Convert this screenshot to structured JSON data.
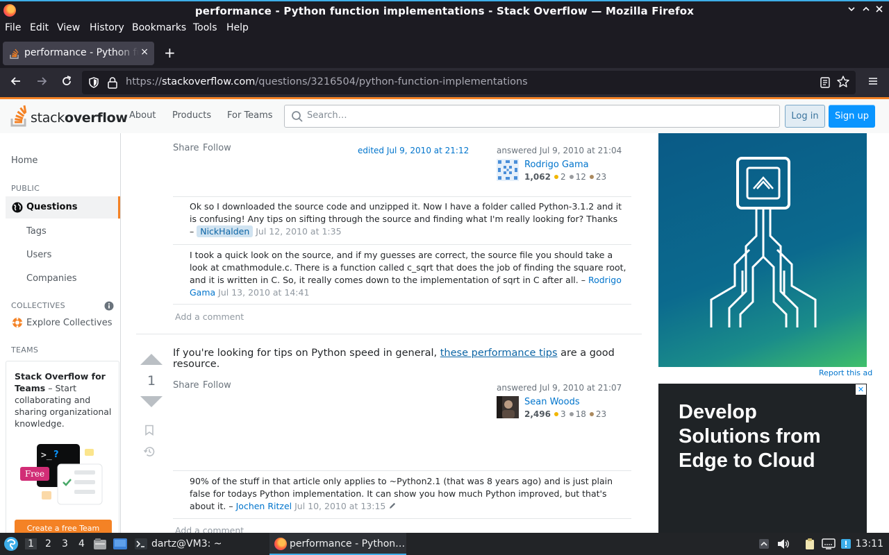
{
  "window": {
    "title": "performance - Python function implementations - Stack Overflow — Mozilla Firefox",
    "controls": [
      "×",
      "⌃",
      "⌄"
    ]
  },
  "menubar": [
    "File",
    "Edit",
    "View",
    "History",
    "Bookmarks",
    "Tools",
    "Help"
  ],
  "tab": {
    "label": "performance - Python function implementations - Stack Overflow",
    "close": "×",
    "new": "+"
  },
  "address": {
    "scheme": "https://",
    "host": "stackoverflow.com",
    "path": "/questions/3216504/python-function-implementations"
  },
  "so_header": {
    "logo_plain": "stack",
    "logo_bold": "overflow",
    "nav": [
      "About",
      "Products",
      "For Teams"
    ],
    "search_placeholder": "Search…",
    "login": "Log in",
    "signup": "Sign up"
  },
  "leftnav": {
    "home": "Home",
    "public": "PUBLIC",
    "questions": "Questions",
    "tags": "Tags",
    "users": "Users",
    "companies": "Companies",
    "collectives": "COLLECTIVES",
    "explore_collectives": "Explore Collectives",
    "teams": "TEAMS",
    "teams_title": "Stack Overflow for Teams",
    "teams_text": " – Start collaborating and sharing organizational knowledge.",
    "free_badge": "Free",
    "cta": "Create a free Team"
  },
  "answer1": {
    "share": "Share",
    "follow": "Follow",
    "edited": "edited Jul 9, 2010 at 21:12",
    "answered": "answered Jul 9, 2010 at 21:04",
    "user": "Rodrigo Gama",
    "rep": "1,062",
    "gold": "2",
    "silver": "12",
    "bronze": "23",
    "comments": [
      {
        "text": "Ok so I downloaded the source code and unzipped it. Now I have a folder called Python-3.1.2 and it is confusing! Any tips on sifting through the source and finding what I'm really looking for? Thanks",
        "dash": "–",
        "user": "NickHalden",
        "date": "Jul 12, 2010 at 1:35"
      },
      {
        "text": "I took a quick look on the source, and if my guesses are correct, the source file you should take a look at cmathmodule.c. There is a function called c_sqrt that does the job of finding the square root, and it is written in C. So, it really comes down to the implementation of sqrt in C after all.",
        "dash": "–",
        "user": "Rodrigo Gama",
        "date": "Jul 13, 2010 at 14:41"
      }
    ],
    "add_comment": "Add a comment"
  },
  "answer2": {
    "vote_count": "1",
    "body_before": "If you're looking for tips on Python speed in general, ",
    "body_link": "these performance tips",
    "body_after": " are a good resource.",
    "share": "Share",
    "follow": "Follow",
    "answered": "answered Jul 9, 2010 at 21:07",
    "user": "Sean Woods",
    "rep": "2,496",
    "gold": "3",
    "silver": "18",
    "bronze": "23",
    "comments": [
      {
        "text": "90% of the stuff in that article only applies to ~Python2.1 (that was 8 years ago) and is just plain false for todays Python implementation. It can show you how much Python improved, but that's about it.",
        "dash": "–",
        "user": "Jochen Ritzel",
        "date": "Jul 10, 2010 at 13:15"
      }
    ],
    "add_comment": "Add a comment"
  },
  "ads": {
    "report": "Report this ad",
    "ad2_text": "Develop Solutions from Edge to Cloud",
    "ad2_close": "✕"
  },
  "taskbar": {
    "workspaces": [
      "1",
      "2",
      "3",
      "4"
    ],
    "terminal": "dartz@VM3: ~",
    "firefox": "performance - Python…",
    "clock": "13:11"
  },
  "colors": {
    "so_orange": "#f48225",
    "so_blue": "#0a95ff",
    "firefox_dark": "#1c1b22",
    "kde_blue": "#3daee9"
  }
}
